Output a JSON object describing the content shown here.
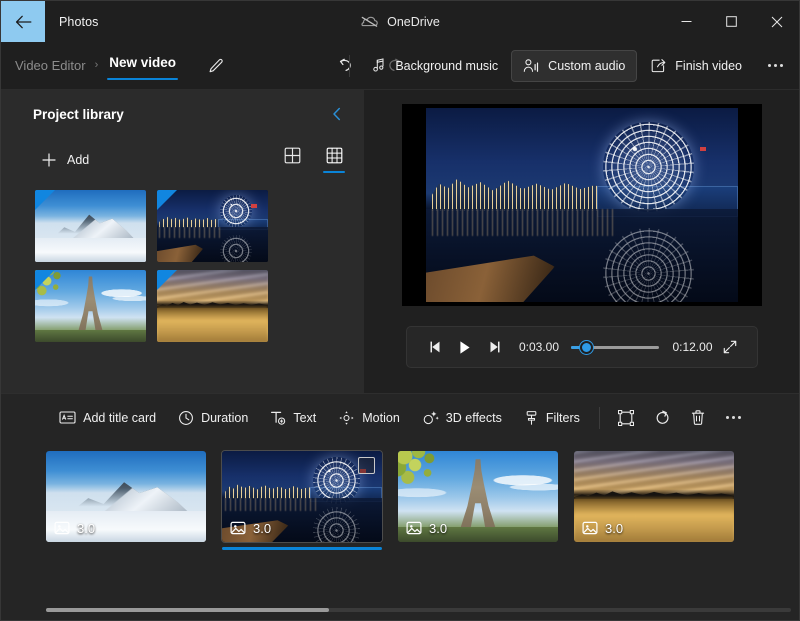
{
  "window": {
    "app_name": "Photos",
    "back_icon": "back-arrow-icon",
    "onedrive_label": "OneDrive",
    "onedrive_icon": "onedrive-cloud-icon",
    "minimize_label": "Minimize",
    "maximize_label": "Maximize",
    "close_label": "Close",
    "accent_color": "#0a84d8",
    "back_button_color": "#8ecaf0"
  },
  "commandbar": {
    "breadcrumb_parent": "Video Editor",
    "breadcrumb_separator": "›",
    "breadcrumb_current": "New video",
    "rename_icon": "pencil-icon",
    "undo_icon": "undo-arrow-icon",
    "redo_icon": "redo-arrow-icon",
    "items": [
      {
        "label": "Background music",
        "icon": "music-note-icon",
        "active": false
      },
      {
        "label": "Custom audio",
        "icon": "person-audio-icon",
        "active": true
      },
      {
        "label": "Finish video",
        "icon": "share-export-icon",
        "active": false
      }
    ],
    "more_label": "See more",
    "more_icon": "ellipsis-icon"
  },
  "library": {
    "title": "Project library",
    "collapse_icon": "chevron-left-icon",
    "add_label": "Add",
    "add_icon": "plus-icon",
    "views": [
      {
        "name": "large-grid-view",
        "icon": "grid-2x2-icon",
        "selected": false
      },
      {
        "name": "small-grid-view",
        "icon": "grid-3x3-icon",
        "selected": true
      }
    ],
    "tiles": [
      {
        "name": "snow-mountain",
        "art": "ph-snow"
      },
      {
        "name": "vancouver-night",
        "art": "ph-night"
      },
      {
        "name": "eiffel-tower",
        "art": "ph-eiffel"
      },
      {
        "name": "golden-city-sunset",
        "art": "ph-sunset"
      }
    ]
  },
  "preview": {
    "current_clip_art": "ph-night",
    "controls": {
      "previous_frame_label": "Previous frame",
      "previous_frame_icon": "step-backward-icon",
      "play_label": "Play",
      "play_icon": "play-icon",
      "next_frame_label": "Next frame",
      "next_frame_icon": "step-forward-icon",
      "current_time": "0:03.00",
      "total_time": "0:12.00",
      "progress_percent": 14,
      "fullscreen_label": "Full screen",
      "fullscreen_icon": "expand-diagonal-icon"
    }
  },
  "storyboard": {
    "toolbar": [
      {
        "label": "Add title card",
        "icon": "title-card-icon"
      },
      {
        "label": "Duration",
        "icon": "clock-icon"
      },
      {
        "label": "Text",
        "icon": "text-icon"
      },
      {
        "label": "Motion",
        "icon": "motion-icon"
      },
      {
        "label": "3D effects",
        "icon": "sparkle-3d-icon"
      },
      {
        "label": "Filters",
        "icon": "filter-brush-icon"
      }
    ],
    "icon_tools": [
      {
        "name": "crop-resize-button",
        "icon": "crop-frame-icon"
      },
      {
        "name": "rotate-button",
        "icon": "rotate-icon"
      },
      {
        "name": "delete-button",
        "icon": "trash-icon"
      },
      {
        "name": "more-options-button",
        "icon": "ellipsis-icon"
      }
    ],
    "clips": [
      {
        "name": "clip-snow-mountain",
        "duration": "3.0",
        "art": "ph-snow",
        "selected": false,
        "media_icon": "photo-icon"
      },
      {
        "name": "clip-vancouver-night",
        "duration": "3.0",
        "art": "ph-night",
        "selected": true,
        "media_icon": "photo-icon"
      },
      {
        "name": "clip-eiffel-tower",
        "duration": "3.0",
        "art": "ph-eiffel",
        "selected": false,
        "media_icon": "photo-icon"
      },
      {
        "name": "clip-golden-city-sunset",
        "duration": "3.0",
        "art": "ph-sunset",
        "selected": false,
        "media_icon": "photo-icon"
      }
    ],
    "scrollbar": {
      "name": "storyboard-scrollbar",
      "thumb_percent": 38
    }
  }
}
